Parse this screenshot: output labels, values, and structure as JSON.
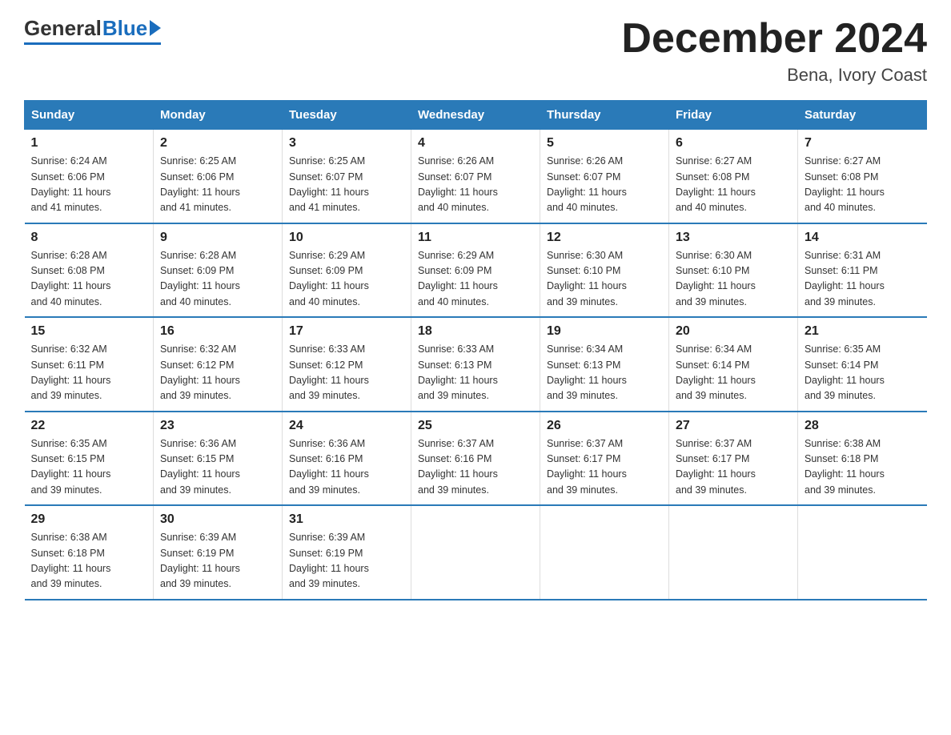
{
  "logo": {
    "general": "General",
    "blue": "Blue",
    "arrow": "▶"
  },
  "title": "December 2024",
  "location": "Bena, Ivory Coast",
  "weekdays": [
    "Sunday",
    "Monday",
    "Tuesday",
    "Wednesday",
    "Thursday",
    "Friday",
    "Saturday"
  ],
  "weeks": [
    [
      {
        "day": "1",
        "sunrise": "6:24 AM",
        "sunset": "6:06 PM",
        "daylight": "11 hours and 41 minutes."
      },
      {
        "day": "2",
        "sunrise": "6:25 AM",
        "sunset": "6:06 PM",
        "daylight": "11 hours and 41 minutes."
      },
      {
        "day": "3",
        "sunrise": "6:25 AM",
        "sunset": "6:07 PM",
        "daylight": "11 hours and 41 minutes."
      },
      {
        "day": "4",
        "sunrise": "6:26 AM",
        "sunset": "6:07 PM",
        "daylight": "11 hours and 40 minutes."
      },
      {
        "day": "5",
        "sunrise": "6:26 AM",
        "sunset": "6:07 PM",
        "daylight": "11 hours and 40 minutes."
      },
      {
        "day": "6",
        "sunrise": "6:27 AM",
        "sunset": "6:08 PM",
        "daylight": "11 hours and 40 minutes."
      },
      {
        "day": "7",
        "sunrise": "6:27 AM",
        "sunset": "6:08 PM",
        "daylight": "11 hours and 40 minutes."
      }
    ],
    [
      {
        "day": "8",
        "sunrise": "6:28 AM",
        "sunset": "6:08 PM",
        "daylight": "11 hours and 40 minutes."
      },
      {
        "day": "9",
        "sunrise": "6:28 AM",
        "sunset": "6:09 PM",
        "daylight": "11 hours and 40 minutes."
      },
      {
        "day": "10",
        "sunrise": "6:29 AM",
        "sunset": "6:09 PM",
        "daylight": "11 hours and 40 minutes."
      },
      {
        "day": "11",
        "sunrise": "6:29 AM",
        "sunset": "6:09 PM",
        "daylight": "11 hours and 40 minutes."
      },
      {
        "day": "12",
        "sunrise": "6:30 AM",
        "sunset": "6:10 PM",
        "daylight": "11 hours and 39 minutes."
      },
      {
        "day": "13",
        "sunrise": "6:30 AM",
        "sunset": "6:10 PM",
        "daylight": "11 hours and 39 minutes."
      },
      {
        "day": "14",
        "sunrise": "6:31 AM",
        "sunset": "6:11 PM",
        "daylight": "11 hours and 39 minutes."
      }
    ],
    [
      {
        "day": "15",
        "sunrise": "6:32 AM",
        "sunset": "6:11 PM",
        "daylight": "11 hours and 39 minutes."
      },
      {
        "day": "16",
        "sunrise": "6:32 AM",
        "sunset": "6:12 PM",
        "daylight": "11 hours and 39 minutes."
      },
      {
        "day": "17",
        "sunrise": "6:33 AM",
        "sunset": "6:12 PM",
        "daylight": "11 hours and 39 minutes."
      },
      {
        "day": "18",
        "sunrise": "6:33 AM",
        "sunset": "6:13 PM",
        "daylight": "11 hours and 39 minutes."
      },
      {
        "day": "19",
        "sunrise": "6:34 AM",
        "sunset": "6:13 PM",
        "daylight": "11 hours and 39 minutes."
      },
      {
        "day": "20",
        "sunrise": "6:34 AM",
        "sunset": "6:14 PM",
        "daylight": "11 hours and 39 minutes."
      },
      {
        "day": "21",
        "sunrise": "6:35 AM",
        "sunset": "6:14 PM",
        "daylight": "11 hours and 39 minutes."
      }
    ],
    [
      {
        "day": "22",
        "sunrise": "6:35 AM",
        "sunset": "6:15 PM",
        "daylight": "11 hours and 39 minutes."
      },
      {
        "day": "23",
        "sunrise": "6:36 AM",
        "sunset": "6:15 PM",
        "daylight": "11 hours and 39 minutes."
      },
      {
        "day": "24",
        "sunrise": "6:36 AM",
        "sunset": "6:16 PM",
        "daylight": "11 hours and 39 minutes."
      },
      {
        "day": "25",
        "sunrise": "6:37 AM",
        "sunset": "6:16 PM",
        "daylight": "11 hours and 39 minutes."
      },
      {
        "day": "26",
        "sunrise": "6:37 AM",
        "sunset": "6:17 PM",
        "daylight": "11 hours and 39 minutes."
      },
      {
        "day": "27",
        "sunrise": "6:37 AM",
        "sunset": "6:17 PM",
        "daylight": "11 hours and 39 minutes."
      },
      {
        "day": "28",
        "sunrise": "6:38 AM",
        "sunset": "6:18 PM",
        "daylight": "11 hours and 39 minutes."
      }
    ],
    [
      {
        "day": "29",
        "sunrise": "6:38 AM",
        "sunset": "6:18 PM",
        "daylight": "11 hours and 39 minutes."
      },
      {
        "day": "30",
        "sunrise": "6:39 AM",
        "sunset": "6:19 PM",
        "daylight": "11 hours and 39 minutes."
      },
      {
        "day": "31",
        "sunrise": "6:39 AM",
        "sunset": "6:19 PM",
        "daylight": "11 hours and 39 minutes."
      },
      null,
      null,
      null,
      null
    ]
  ],
  "labels": {
    "sunrise": "Sunrise:",
    "sunset": "Sunset:",
    "daylight": "Daylight:"
  },
  "colors": {
    "header_bg": "#2a7ab8",
    "header_text": "#ffffff",
    "border": "#2a7ab8"
  }
}
